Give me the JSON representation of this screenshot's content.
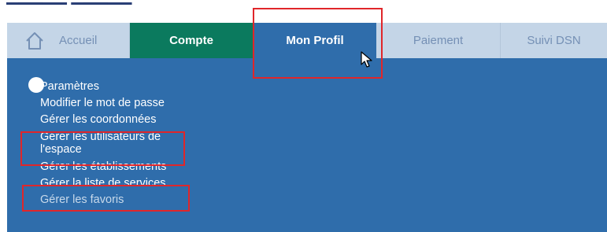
{
  "navbar": {
    "home_label": "Accueil",
    "tabs": [
      {
        "label": "Compte"
      },
      {
        "label": "Mon Profil"
      },
      {
        "label": "Paiement"
      },
      {
        "label": "Suivi DSN"
      }
    ]
  },
  "menu": {
    "items": [
      {
        "label": "Paramètres"
      },
      {
        "label": "Modifier le mot de passe"
      },
      {
        "label": "Gérer les coordonnées"
      },
      {
        "label": "Gérer les utilisateurs de l'espace"
      },
      {
        "label": "Gérer les établissements"
      },
      {
        "label": "Gérer la liste de services"
      },
      {
        "label": "Gérer les favoris"
      }
    ]
  },
  "colors": {
    "nav_background": "#c4d5e7",
    "compte_active": "#0b7a5e",
    "profil_active": "#2f6dab",
    "highlight_box": "#e0262a"
  },
  "icons": {
    "home": "home-icon",
    "cursor": "mouse-cursor-icon"
  }
}
